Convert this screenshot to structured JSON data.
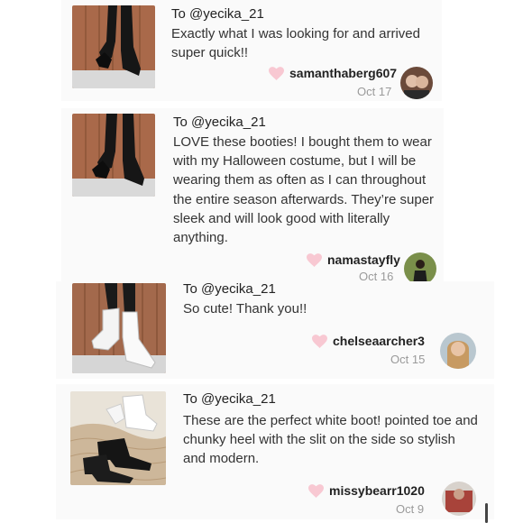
{
  "reviews": [
    {
      "to": "To @yecika_21",
      "text": "Exactly what I was looking for and arrived super quick!!",
      "username": "samanthaberg607",
      "date": "Oct 17",
      "boot_color": "black"
    },
    {
      "to": "To @yecika_21",
      "text": "LOVE these booties! I bought them to wear with my Halloween costume, but I will be wearing them as often as I can throughout the entire season afterwards. They’re super sleek and will look good with literally anything.",
      "username": "namastayfly",
      "date": "Oct 16",
      "boot_color": "black"
    },
    {
      "to": "To @yecika_21",
      "text": "So cute! Thank you!!",
      "username": "chelseaarcher3",
      "date": "Oct 15",
      "boot_color": "white"
    },
    {
      "to": "To @yecika_21",
      "text": "These are the perfect white boot! pointed toe and chunky heel with the slit on the side so stylish and modern.",
      "username": "missybearr1020",
      "date": "Oct 9",
      "boot_color": "black and white"
    }
  ],
  "icons": {
    "like": "heart-icon"
  },
  "colors": {
    "heart": "#f8c8d2",
    "date": "#9a9a9a",
    "card_background": "#fafafa"
  }
}
